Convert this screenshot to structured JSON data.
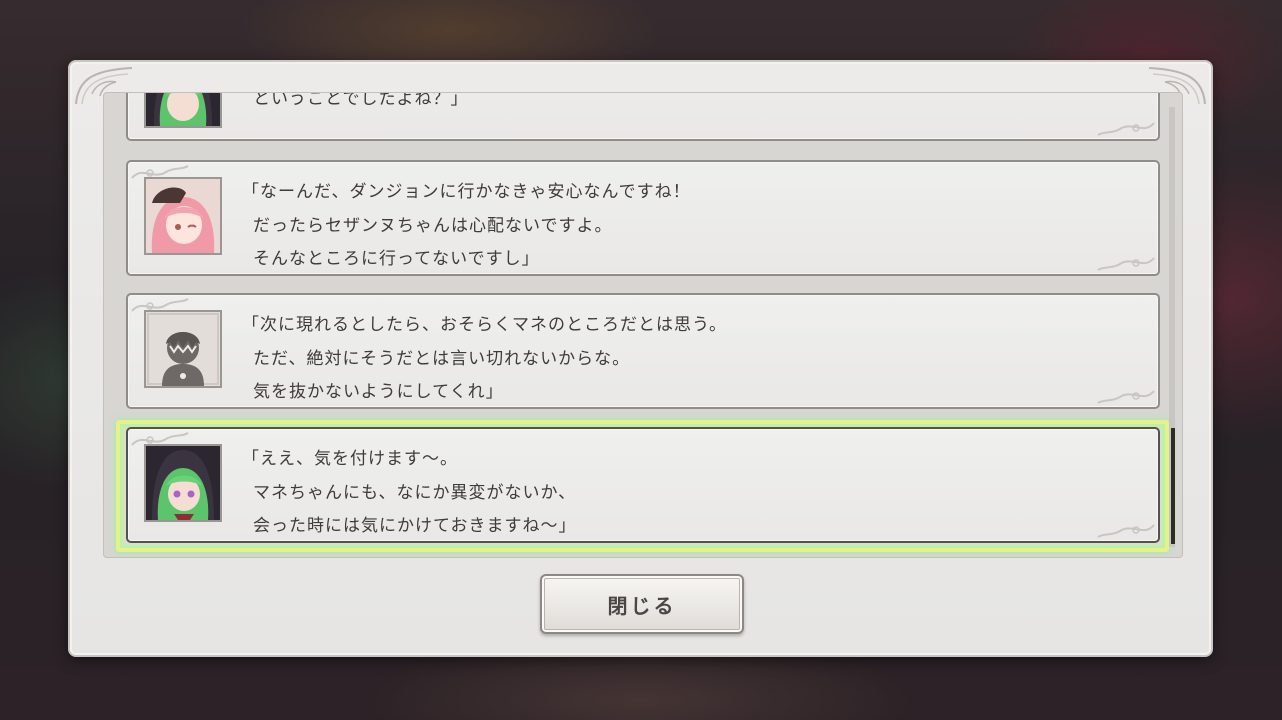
{
  "dialog": {
    "close_label": "閉じる",
    "entries": [
      {
        "speaker_icon": "green-hair-hooded-girl-portrait",
        "lines": [
          "",
          "ということでしたよね？」"
        ]
      },
      {
        "speaker_icon": "pink-hair-girl-portrait",
        "lines": [
          "「なーんだ、ダンジョンに行かなきゃ安心なんですね！",
          "だったらセザンヌちゃんは心配ないですよ。",
          "そんなところに行ってないですし」"
        ]
      },
      {
        "speaker_icon": "silhouette-portrait",
        "lines": [
          "「次に現れるとしたら、おそらくマネのところだとは思う。",
          "ただ、絶対にそうだとは言い切れないからな。",
          "気を抜かないようにしてくれ」"
        ]
      },
      {
        "speaker_icon": "green-hair-hooded-girl-portrait",
        "lines": [
          "「ええ、気を付けます～。",
          "マネちゃんにも、なにか異変がないか、",
          "会った時には気にかけておきますね～」"
        ]
      }
    ]
  },
  "colors": {
    "text": "#3f3b3a",
    "selected_glow": "#e4f28a",
    "scroll_thumb": "#2e2c2a"
  }
}
